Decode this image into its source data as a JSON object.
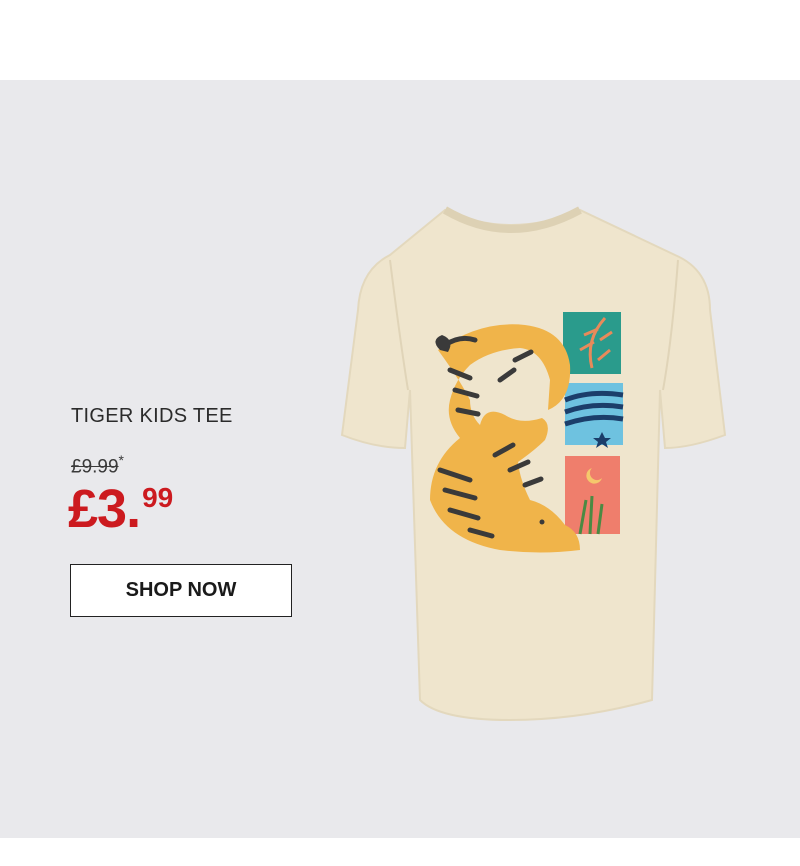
{
  "product": {
    "name": "TIGER KIDS TEE",
    "old_price": "£9.99",
    "old_price_mark": "*",
    "new_price_main": "£3.",
    "new_price_pennies": "99",
    "cta_label": "SHOP NOW"
  },
  "colors": {
    "banner_bg": "#e9e9ec",
    "price_red": "#cc1a1f",
    "tee": "#eee4cc"
  },
  "image": {
    "icon": "tiger-tshirt-illustration"
  }
}
